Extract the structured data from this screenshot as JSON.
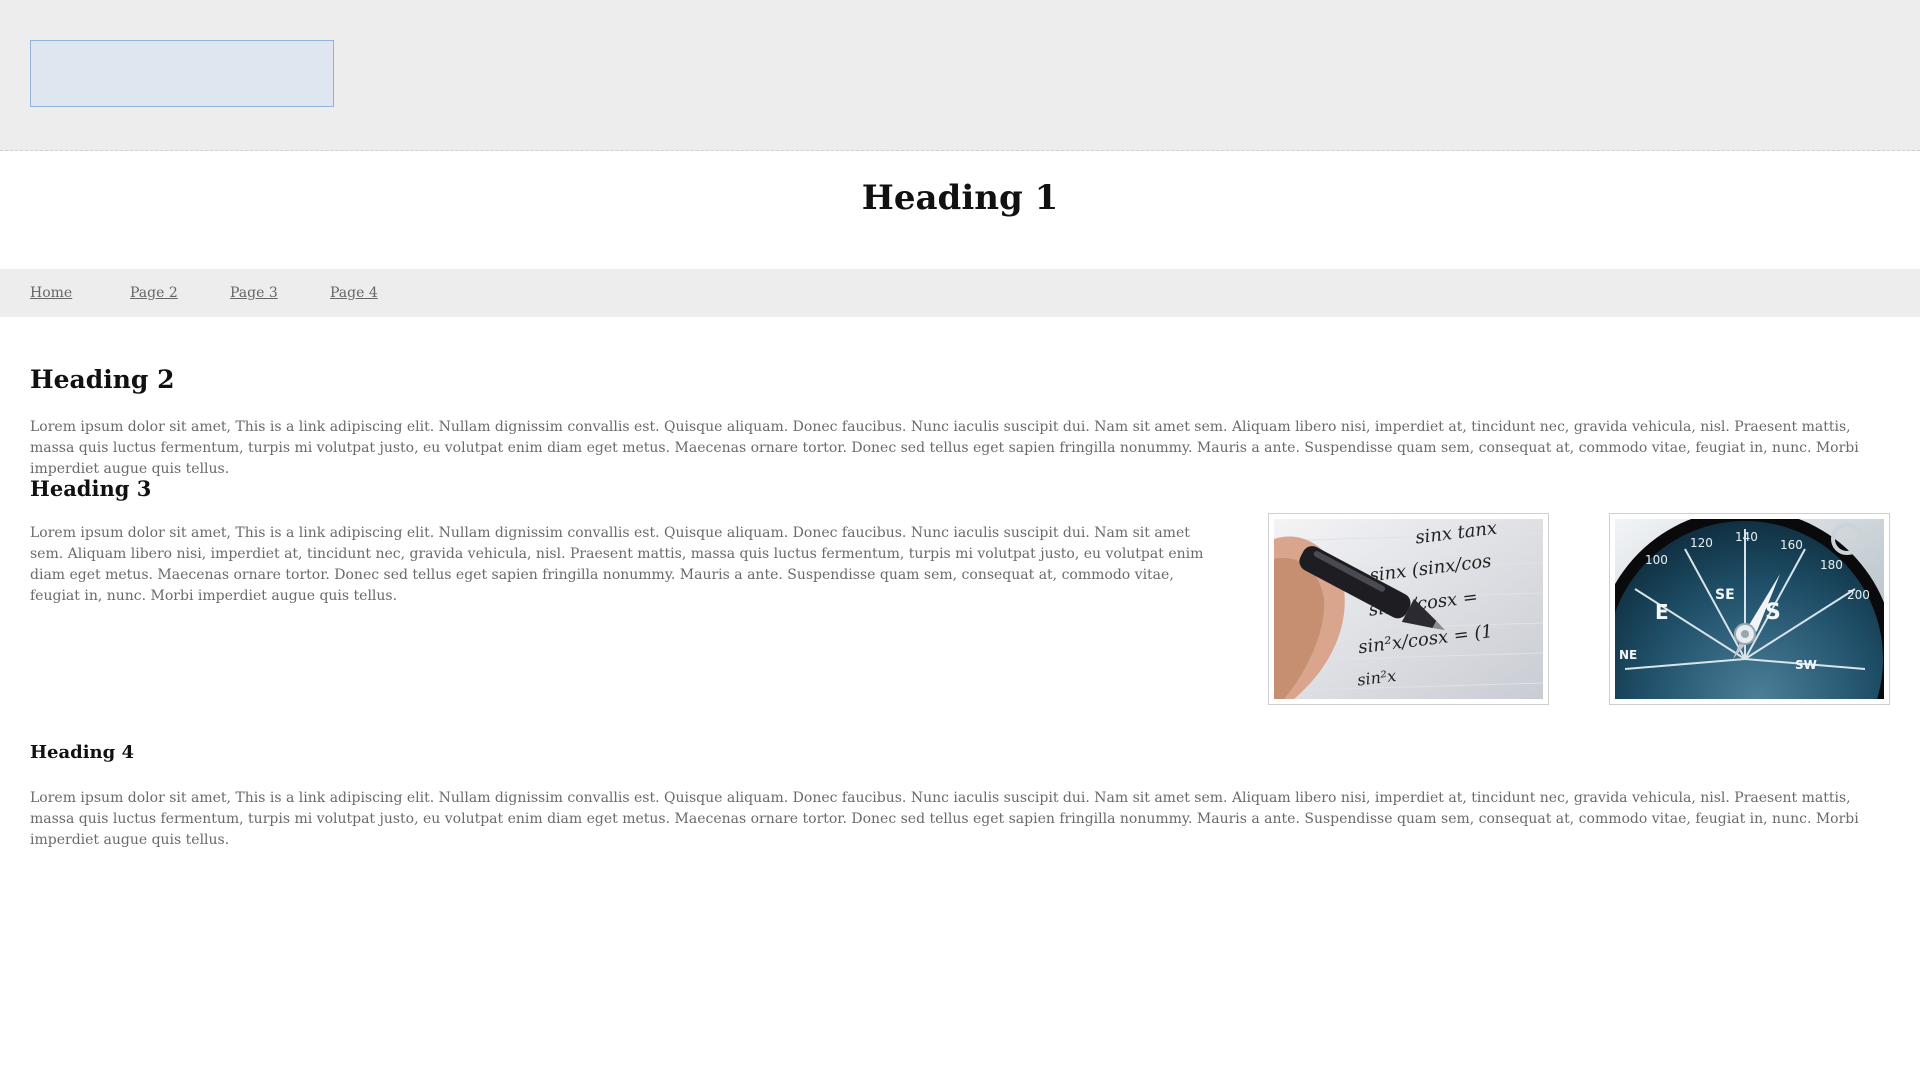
{
  "header": {
    "logo_label": ""
  },
  "heading1": "Heading 1",
  "nav": {
    "items": [
      {
        "label": "Home"
      },
      {
        "label": "Page 2"
      },
      {
        "label": "Page 3"
      },
      {
        "label": "Page 4"
      }
    ]
  },
  "content": {
    "heading2": "Heading 2",
    "para1": {
      "before": "Lorem ipsum dolor sit amet, ",
      "link": "This is a link",
      "after": " adipiscing elit. Nullam dignissim convallis est. Quisque aliquam. Donec faucibus. Nunc iaculis suscipit dui. Nam sit amet sem. Aliquam libero nisi, imperdiet at, tincidunt nec, gravida vehicula, nisl. Praesent mattis, massa quis luctus fermentum, turpis mi volutpat justo, eu volutpat enim diam eget metus. Maecenas ornare tortor. Donec sed tellus eget sapien fringilla nonummy. Mauris a ante. Suspendisse quam sem, consequat at, commodo vitae, feugiat in, nunc. Morbi imperdiet augue quis tellus."
    },
    "heading3": "Heading 3",
    "para2": {
      "before": "Lorem ipsum dolor sit amet, ",
      "link": "This is a link",
      "after": " adipiscing elit. Nullam dignissim convallis est. Quisque aliquam. Donec faucibus. Nunc iaculis suscipit dui. Nam sit amet sem. Aliquam libero nisi, imperdiet at, tincidunt nec, gravida vehicula, nisl. Praesent mattis, massa quis luctus fermentum, turpis mi volutpat justo, eu volutpat enim diam eget metus. Maecenas ornare tortor. Donec sed tellus eget sapien fringilla nonummy. Mauris a ante. Suspendisse quam sem, consequat at, commodo vitae, feugiat in, nunc. Morbi imperdiet augue quis tellus."
    },
    "heading4": "Heading 4",
    "para3": {
      "before": "Lorem ipsum dolor sit amet, ",
      "link": "This is a link",
      "after": " adipiscing elit. Nullam dignissim convallis est. Quisque aliquam. Donec faucibus. Nunc iaculis suscipit dui. Nam sit amet sem. Aliquam libero nisi, imperdiet at, tincidunt nec, gravida vehicula, nisl. Praesent mattis, massa quis luctus fermentum, turpis mi volutpat justo, eu volutpat enim diam eget metus. Maecenas ornare tortor. Donec sed tellus eget sapien fringilla nonummy. Mauris a ante. Suspendisse quam sem, consequat at, commodo vitae, feugiat in, nunc. Morbi imperdiet augue quis tellus."
    }
  },
  "images": {
    "math_lines": [
      "sinx tanx",
      "sinx (sinx/cos",
      "sin x/cosx =",
      "sin²x/cosx = (1",
      "sin²x"
    ],
    "compass_ticks": [
      "100",
      "120",
      "140",
      "160",
      "180",
      "200"
    ],
    "compass_dirs": [
      "SE",
      "S",
      "E",
      "NE",
      "SW"
    ]
  },
  "colors": {
    "header_bg": "#ededed",
    "logo_fill": "#e0e6ef",
    "logo_border": "#8fb3dc",
    "body_text": "#6a6a6a",
    "heading_text": "#111111"
  }
}
